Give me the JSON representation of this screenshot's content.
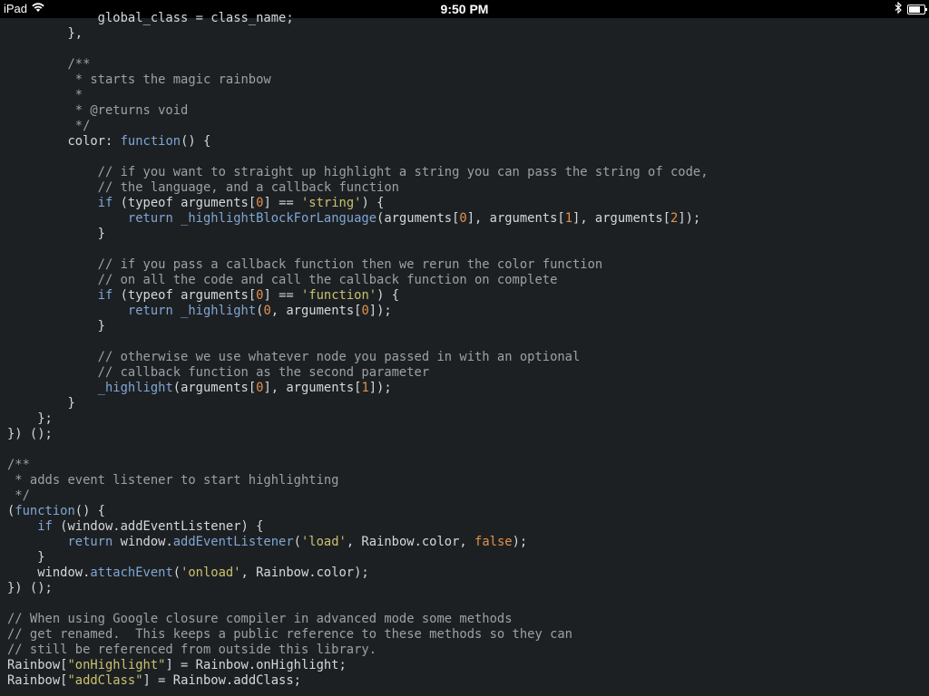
{
  "status_bar": {
    "device": "iPad",
    "time": "9:50 PM",
    "wifi_icon": "wifi-icon",
    "bluetooth_icon": "bluetooth-icon",
    "battery_icon": "battery-icon",
    "battery_level": 0.75
  },
  "colors": {
    "background": "#1d2023",
    "plain": "#d5d8da",
    "comment": "#9aa1a6",
    "keyword": "#7fa6d4",
    "string": "#c9c26e",
    "number": "#e0924a"
  },
  "code_lines": [
    [
      [
        "plain",
        "            global_class = class_name;"
      ]
    ],
    [
      [
        "plain",
        "        },"
      ]
    ],
    [
      [
        "plain",
        ""
      ]
    ],
    [
      [
        "comment",
        "        /**"
      ]
    ],
    [
      [
        "comment",
        "         * starts the magic rainbow"
      ]
    ],
    [
      [
        "comment",
        "         *"
      ]
    ],
    [
      [
        "comment",
        "         * @returns void"
      ]
    ],
    [
      [
        "comment",
        "         */"
      ]
    ],
    [
      [
        "plain",
        "        color: "
      ],
      [
        "keyword",
        "function"
      ],
      [
        "plain",
        "() {"
      ]
    ],
    [
      [
        "plain",
        ""
      ]
    ],
    [
      [
        "comment",
        "            // if you want to straight up highlight a string you can pass the string of code,"
      ]
    ],
    [
      [
        "comment",
        "            // the language, and a callback function"
      ]
    ],
    [
      [
        "plain",
        "            "
      ],
      [
        "keyword",
        "if"
      ],
      [
        "plain",
        " (typeof arguments["
      ],
      [
        "number",
        "0"
      ],
      [
        "plain",
        "] == "
      ],
      [
        "string",
        "'string'"
      ],
      [
        "plain",
        ") {"
      ]
    ],
    [
      [
        "plain",
        "                "
      ],
      [
        "keyword",
        "return"
      ],
      [
        "plain",
        " "
      ],
      [
        "func",
        "_highlightBlockForLanguage"
      ],
      [
        "plain",
        "(arguments["
      ],
      [
        "number",
        "0"
      ],
      [
        "plain",
        "], arguments["
      ],
      [
        "number",
        "1"
      ],
      [
        "plain",
        "], arguments["
      ],
      [
        "number",
        "2"
      ],
      [
        "plain",
        "]);"
      ]
    ],
    [
      [
        "plain",
        "            }"
      ]
    ],
    [
      [
        "plain",
        ""
      ]
    ],
    [
      [
        "comment",
        "            // if you pass a callback function then we rerun the color function"
      ]
    ],
    [
      [
        "comment",
        "            // on all the code and call the callback function on complete"
      ]
    ],
    [
      [
        "plain",
        "            "
      ],
      [
        "keyword",
        "if"
      ],
      [
        "plain",
        " (typeof arguments["
      ],
      [
        "number",
        "0"
      ],
      [
        "plain",
        "] == "
      ],
      [
        "string",
        "'function'"
      ],
      [
        "plain",
        ") {"
      ]
    ],
    [
      [
        "plain",
        "                "
      ],
      [
        "keyword",
        "return"
      ],
      [
        "plain",
        " "
      ],
      [
        "func",
        "_highlight"
      ],
      [
        "plain",
        "("
      ],
      [
        "number",
        "0"
      ],
      [
        "plain",
        ", arguments["
      ],
      [
        "number",
        "0"
      ],
      [
        "plain",
        "]);"
      ]
    ],
    [
      [
        "plain",
        "            }"
      ]
    ],
    [
      [
        "plain",
        ""
      ]
    ],
    [
      [
        "comment",
        "            // otherwise we use whatever node you passed in with an optional"
      ]
    ],
    [
      [
        "comment",
        "            // callback function as the second parameter"
      ]
    ],
    [
      [
        "plain",
        "            "
      ],
      [
        "func",
        "_highlight"
      ],
      [
        "plain",
        "(arguments["
      ],
      [
        "number",
        "0"
      ],
      [
        "plain",
        "], arguments["
      ],
      [
        "number",
        "1"
      ],
      [
        "plain",
        "]);"
      ]
    ],
    [
      [
        "plain",
        "        }"
      ]
    ],
    [
      [
        "plain",
        "    };"
      ]
    ],
    [
      [
        "plain",
        "}) ();"
      ]
    ],
    [
      [
        "plain",
        ""
      ]
    ],
    [
      [
        "comment",
        "/**"
      ]
    ],
    [
      [
        "comment",
        " * adds event listener to start highlighting"
      ]
    ],
    [
      [
        "comment",
        " */"
      ]
    ],
    [
      [
        "plain",
        "("
      ],
      [
        "keyword",
        "function"
      ],
      [
        "plain",
        "() {"
      ]
    ],
    [
      [
        "plain",
        "    "
      ],
      [
        "keyword",
        "if"
      ],
      [
        "plain",
        " (window.addEventListener) {"
      ]
    ],
    [
      [
        "plain",
        "        "
      ],
      [
        "keyword",
        "return"
      ],
      [
        "plain",
        " window."
      ],
      [
        "func",
        "addEventListener"
      ],
      [
        "plain",
        "("
      ],
      [
        "string",
        "'load'"
      ],
      [
        "plain",
        ", Rainbow.color, "
      ],
      [
        "boolean",
        "false"
      ],
      [
        "plain",
        ");"
      ]
    ],
    [
      [
        "plain",
        "    }"
      ]
    ],
    [
      [
        "plain",
        "    window."
      ],
      [
        "func",
        "attachEvent"
      ],
      [
        "plain",
        "("
      ],
      [
        "string",
        "'onload'"
      ],
      [
        "plain",
        ", Rainbow.color);"
      ]
    ],
    [
      [
        "plain",
        "}) ();"
      ]
    ],
    [
      [
        "plain",
        ""
      ]
    ],
    [
      [
        "comment",
        "// When using Google closure compiler in advanced mode some methods"
      ]
    ],
    [
      [
        "comment",
        "// get renamed.  This keeps a public reference to these methods so they can"
      ]
    ],
    [
      [
        "comment",
        "// still be referenced from outside this library."
      ]
    ],
    [
      [
        "plain",
        "Rainbow["
      ],
      [
        "string",
        "\"onHighlight\""
      ],
      [
        "plain",
        "] = Rainbow.onHighlight;"
      ]
    ],
    [
      [
        "plain",
        "Rainbow["
      ],
      [
        "string",
        "\"addClass\""
      ],
      [
        "plain",
        "] = Rainbow.addClass;"
      ]
    ]
  ]
}
